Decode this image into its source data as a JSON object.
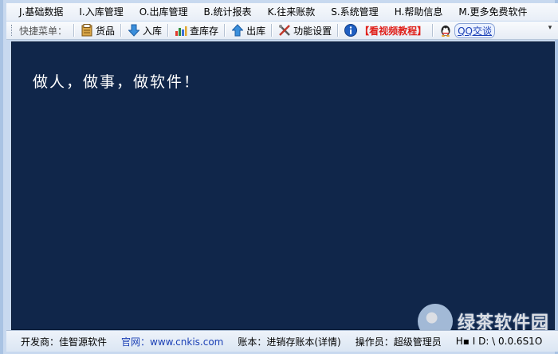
{
  "menu": [
    "J.基础数据",
    "I.入库管理",
    "O.出库管理",
    "B.统计报表",
    "K.往来账款",
    "S.系统管理",
    "H.帮助信息",
    "M.更多免费软件"
  ],
  "toolbar": {
    "label": "快捷菜单：",
    "buttons": [
      "货品",
      "入库",
      "查库存",
      "出库",
      "功能设置"
    ],
    "video_tutorial": "【看视频教程】",
    "qq": "QQ交谈",
    "chevron": "▾"
  },
  "content": {
    "slogan": "做人，做事，做软件！",
    "background_color": "#10264a"
  },
  "watermark": {
    "text": "绿茶软件园"
  },
  "status": {
    "developer": "开发商：佳智源软件",
    "website": "官网：www.cnkis.com",
    "account": "账本：进销存账本(详情)",
    "operator": "操作员：超级管理员",
    "hid": "H▪ I D: \\ 0.0.6S1O"
  },
  "icons": {
    "goods": "goods-icon",
    "stock_in": "arrow-down-icon",
    "inventory": "bar-chart-icon",
    "stock_out": "arrow-up-icon",
    "settings": "tools-icon",
    "info": "info-icon",
    "qq": "qq-penguin-icon"
  }
}
